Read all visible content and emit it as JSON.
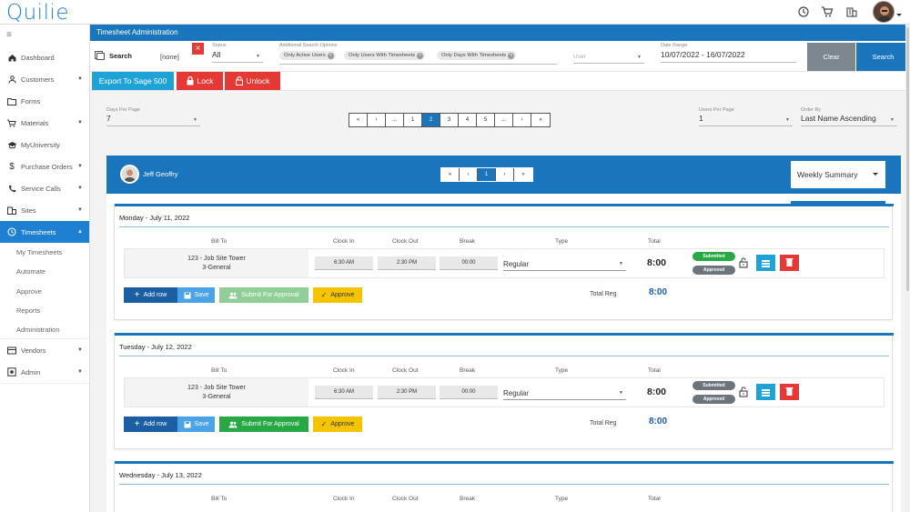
{
  "app": {
    "logo": "Quilie"
  },
  "topbar": {
    "icons": [
      "clock-icon",
      "cart-icon",
      "building-icon"
    ],
    "avatar": "user-avatar"
  },
  "sidebar": {
    "items": [
      {
        "label": "Dashboard",
        "icon": "home-icon",
        "caret": ""
      },
      {
        "label": "Customers",
        "icon": "person-icon",
        "caret": "▼"
      },
      {
        "label": "Forms",
        "icon": "folder-icon",
        "caret": ""
      },
      {
        "label": "Materials",
        "icon": "cart-icon",
        "caret": "▼"
      },
      {
        "label": "MyUniversity",
        "icon": "graduation-cap-icon",
        "caret": ""
      },
      {
        "label": "Purchase Orders",
        "icon": "dollar-icon",
        "caret": "▼"
      },
      {
        "label": "Service Calls",
        "icon": "phone-icon",
        "caret": "▼"
      },
      {
        "label": "Sites",
        "icon": "building-icon",
        "caret": "▼"
      },
      {
        "label": "Timesheets",
        "icon": "clock-icon",
        "caret": "▲"
      }
    ],
    "sub_items": [
      "My Timesheets",
      "Automate",
      "Approve",
      "Reports",
      "Administration"
    ],
    "bottom_items": [
      {
        "label": "Vendors",
        "icon": "vendor-icon",
        "caret": "▼"
      },
      {
        "label": "Admin",
        "icon": "gear-icon",
        "caret": "▼"
      }
    ]
  },
  "header": {
    "title": "Timesheet Administration"
  },
  "filters": {
    "search_label": "Search",
    "none_label": "[none]",
    "status_label": "Status",
    "status_value": "All",
    "additional_label": "Additional Search Options",
    "chips": [
      "Only Active Users",
      "Only Users With Timesheets",
      "Only Days With Timesheets"
    ],
    "user_placeholder": "User",
    "date_range_label": "Date Range",
    "date_range_value": "10/07/2022 - 16/07/2022",
    "clear_label": "Clear",
    "search_button_label": "Search"
  },
  "actions": {
    "export_label": "Export To Sage 500",
    "lock_label": "Lock",
    "unlock_label": "Unlock"
  },
  "controls": {
    "days_per_page_label": "Days Per Page",
    "days_per_page_value": "7",
    "pages": [
      "«",
      "‹",
      "...",
      "1",
      "2",
      "3",
      "4",
      "5",
      "...",
      "›",
      "»"
    ],
    "active_page": "2",
    "users_per_page_label": "Users Per Page",
    "users_per_page_value": "1",
    "order_by_label": "Order By",
    "order_by_value": "Last Name Ascending"
  },
  "user": {
    "name": "Jeff Geoffry",
    "pages": [
      "«",
      "‹",
      "1",
      "›",
      "»"
    ],
    "active_page": "1",
    "view_label": "Weekly Summary"
  },
  "columns": {
    "bill_to": "Bill To",
    "clock_in": "Clock In",
    "clock_out": "Clock Out",
    "break": "Break",
    "type": "Type",
    "total": "Total"
  },
  "days": [
    {
      "title": "Monday - July 11, 2022",
      "bill_to_line1": "123 - Job Site Tower",
      "bill_to_line2": "3-General",
      "clock_in": "6:30 AM",
      "clock_out": "2:30 PM",
      "break": "00:00",
      "type": "Regular",
      "total": "8:00",
      "badge_submitted": "Submitted",
      "badge_approved": "Approved",
      "add_row": "Add row",
      "save": "Save",
      "submit": "Submit For Approval",
      "approve": "Approve",
      "total_reg_label": "Total Reg",
      "total_reg_value": "8:00"
    },
    {
      "title": "Tuesday - July 12, 2022",
      "bill_to_line1": "123 - Job Site Tower",
      "bill_to_line2": "3-General",
      "clock_in": "6:30 AM",
      "clock_out": "2:30 PM",
      "break": "00:00",
      "type": "Regular",
      "total": "8:00",
      "badge_submitted": "Submitted",
      "badge_approved": "Approved",
      "add_row": "Add row",
      "save": "Save",
      "submit": "Submit For Approval",
      "approve": "Approve",
      "total_reg_label": "Total Reg",
      "total_reg_value": "8:00"
    },
    {
      "title": "Wednesday - July 13, 2022"
    }
  ],
  "colors": {
    "primary": "#1b75bc",
    "danger": "#e53935",
    "success": "#28a745",
    "warning": "#f5c400",
    "info": "#1fa2d6"
  }
}
